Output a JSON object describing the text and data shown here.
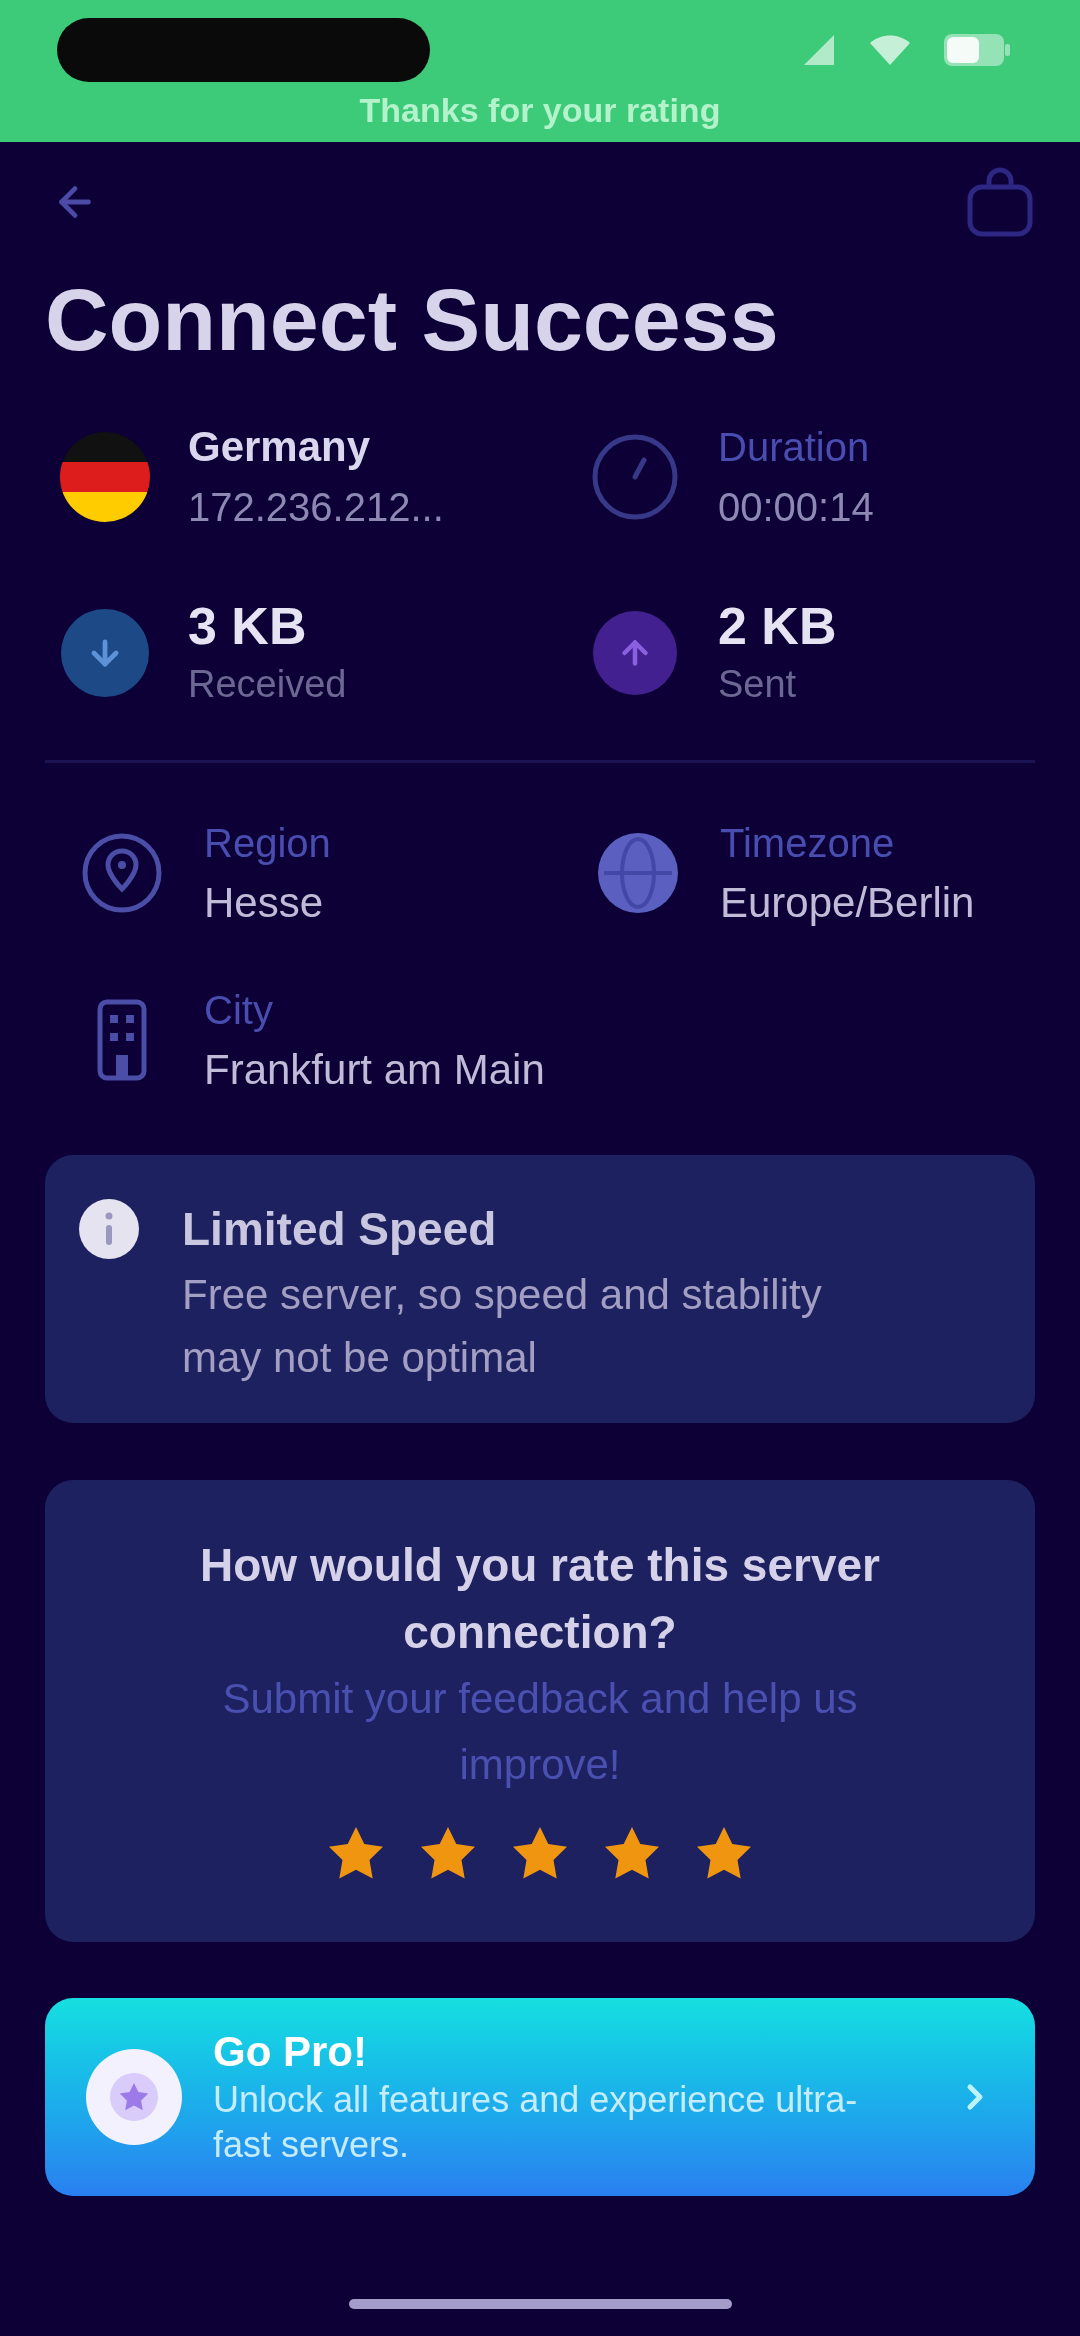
{
  "status_bar": {
    "toast": "Thanks for your rating"
  },
  "title": "Connect Success",
  "server": {
    "country": "Germany",
    "ip": "172.236.212..."
  },
  "duration": {
    "label": "Duration",
    "value": "00:00:14"
  },
  "traffic": [
    {
      "kind": "received",
      "value": "3 KB",
      "label": "Received"
    },
    {
      "kind": "sent",
      "value": "2 KB",
      "label": "Sent"
    }
  ],
  "location": [
    {
      "kind": "region",
      "label": "Region",
      "value": "Hesse"
    },
    {
      "kind": "timezone",
      "label": "Timezone",
      "value": "Europe/Berlin"
    },
    {
      "kind": "city",
      "label": "City",
      "value": "Frankfurt am Main"
    }
  ],
  "notice": {
    "title": "Limited Speed",
    "text": "Free server, so speed and stability may not be optimal"
  },
  "rating": {
    "title": "How would you rate this server connection?",
    "subtitle": "Submit your feedback and help us improve!",
    "stars": 5
  },
  "promo": {
    "title": "Go Pro!",
    "text": "Unlock all features and experience ultra-fast servers."
  }
}
